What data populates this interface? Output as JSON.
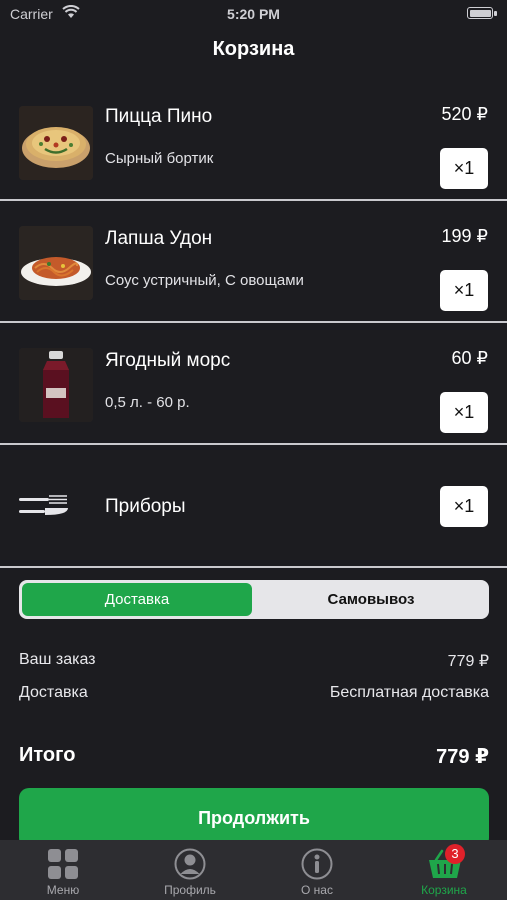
{
  "status": {
    "carrier": "Carrier",
    "time": "5:20 PM"
  },
  "header": {
    "title": "Корзина"
  },
  "cart": {
    "items": [
      {
        "name": "Пицца Пино",
        "desc": "Сырный бортик",
        "price": "520 ₽",
        "qty": "×1",
        "image": "pizza-image"
      },
      {
        "name": "Лапша Удон",
        "desc": "Соус устричный, С овощами",
        "price": "199 ₽",
        "qty": "×1",
        "image": "noodles-image"
      },
      {
        "name": "Ягодный морс",
        "desc": "0,5 л. - 60 р.",
        "price": "60 ₽",
        "qty": "×1",
        "image": "drink-bottle-image"
      }
    ],
    "cutlery": {
      "name": "Приборы",
      "qty": "×1",
      "icon": "cutlery-icon"
    }
  },
  "delivery_toggle": {
    "delivery": "Доставка",
    "pickup": "Самовывоз",
    "selected": "Доставка"
  },
  "summary": {
    "order_label": "Ваш заказ",
    "order_value": "779 ₽",
    "delivery_label": "Доставка",
    "delivery_value": "Бесплатная доставка",
    "total_label": "Итого",
    "total_value": "779 ₽"
  },
  "cta": {
    "label": "Продолжить"
  },
  "tabbar": {
    "tabs": [
      {
        "label": "Меню",
        "icon": "grid-icon"
      },
      {
        "label": "Профиль",
        "icon": "user-icon"
      },
      {
        "label": "О нас",
        "icon": "info-icon"
      },
      {
        "label": "Корзина",
        "icon": "basket-icon",
        "badge": "3",
        "active": true
      }
    ]
  },
  "colors": {
    "accent": "#1fa64a",
    "background": "#1c1c20",
    "badge": "#e0212a"
  }
}
